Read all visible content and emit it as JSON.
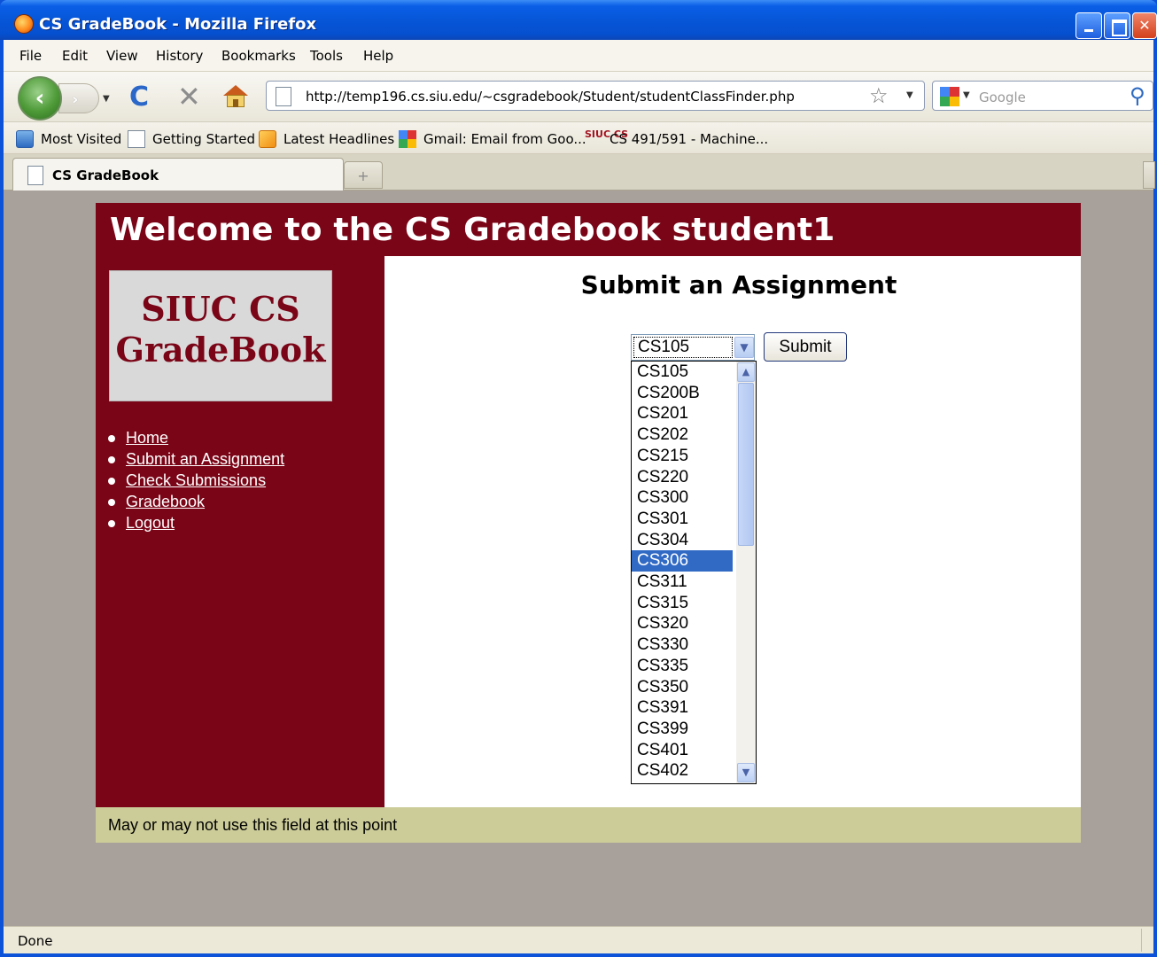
{
  "window": {
    "title": "CS GradeBook - Mozilla Firefox",
    "minimize_glyph": "",
    "maximize_glyph": "",
    "close_glyph": "✕"
  },
  "menu": {
    "items": [
      "File",
      "Edit",
      "View",
      "History",
      "Bookmarks",
      "Tools",
      "Help"
    ]
  },
  "navigation": {
    "back_glyph": "‹",
    "forward_glyph": "›",
    "url": "http://temp196.cs.siu.edu/~csgradebook/Student/studentClassFinder.php",
    "search_placeholder": "Google",
    "icons": [
      "back-icon",
      "forward-icon",
      "reload-icon",
      "stop-icon",
      "home-icon",
      "bookmark-star-icon",
      "search-magnifier-icon"
    ]
  },
  "bookmarks": {
    "items": [
      {
        "label": "Most Visited",
        "icon": "most-visited-icon"
      },
      {
        "label": "Getting Started",
        "icon": "page-icon"
      },
      {
        "label": "Latest Headlines",
        "icon": "rss-icon"
      },
      {
        "label": "Gmail: Email from Goo...",
        "icon": "google-icon"
      },
      {
        "label": "CS 491/591 - Machine...",
        "icon": "siuc-cs-icon"
      }
    ],
    "siuc_icon_text": "SIUC\nCS"
  },
  "tabs": {
    "active_label": "CS GradeBook",
    "new_tab_glyph": "+"
  },
  "page": {
    "header": "Welcome to the CS Gradebook student1",
    "logo_line1": "SIUC CS",
    "logo_line2": "GradeBook",
    "nav_links": [
      "Home",
      "Submit an Assignment",
      "Check Submissions",
      "Gradebook",
      "Logout"
    ],
    "heading": "Submit an Assignment",
    "select": {
      "value": "CS105",
      "options": [
        "CS105",
        "CS200B",
        "CS201",
        "CS202",
        "CS215",
        "CS220",
        "CS300",
        "CS301",
        "CS304",
        "CS306",
        "CS311",
        "CS315",
        "CS320",
        "CS330",
        "CS335",
        "CS350",
        "CS391",
        "CS399",
        "CS401",
        "CS402"
      ],
      "highlighted": "CS306"
    },
    "submit_label": "Submit",
    "footer": "May or may not use this field at this point"
  },
  "status": {
    "text": "Done"
  },
  "colors": {
    "maroon": "#7a0517",
    "footer": "#cccc99",
    "selection": "#316ac5",
    "background": "#a8a09a"
  }
}
